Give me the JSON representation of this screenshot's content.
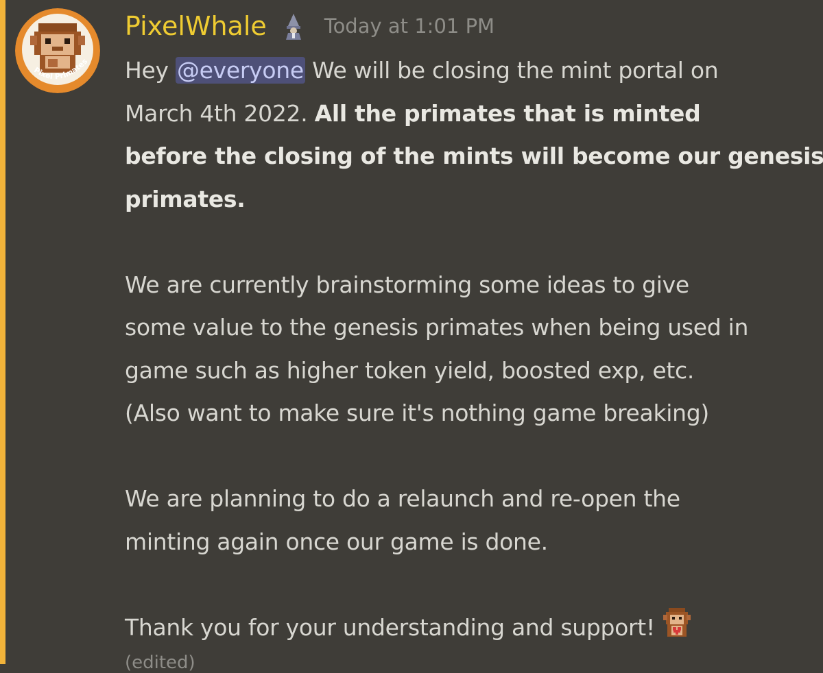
{
  "message": {
    "author": "PixelWhale",
    "timestamp": "Today at 1:01 PM",
    "avatar_caption": "Pixel Primates",
    "mention": "@everyone",
    "lines": {
      "l1_pre": "Hey ",
      "l1_post": " We will be closing the mint portal on",
      "l2_pre": "March 4th 2022. ",
      "l2_bold": "All the primates that is minted",
      "l3_bold": "before the closing of the mints will become our genesis",
      "l4_bold": "primates.",
      "p2_l1": "We are currently brainstorming some ideas to give",
      "p2_l2": "some value to the genesis primates when being used in",
      "p2_l3": "game such as higher token yield, boosted exp, etc.",
      "p2_l4": "(Also want to make sure it's nothing game breaking)",
      "p3_l1": "We are planning to do a relaunch and re-open the",
      "p3_l2": "minting again once our game is done.",
      "p4_l1": "Thank you for your understanding and support!"
    },
    "edited_label": "(edited)"
  },
  "colors": {
    "background": "#3f3d38",
    "mention_highlight_bar": "#f1b33a",
    "username": "#efcc32",
    "timestamp": "#8e8d88",
    "text": "#d8d7d1",
    "mention_bg": "#4e5078"
  },
  "icons": {
    "role_icon": "wizard-icon",
    "emoji": "primate-heart-emoji"
  }
}
